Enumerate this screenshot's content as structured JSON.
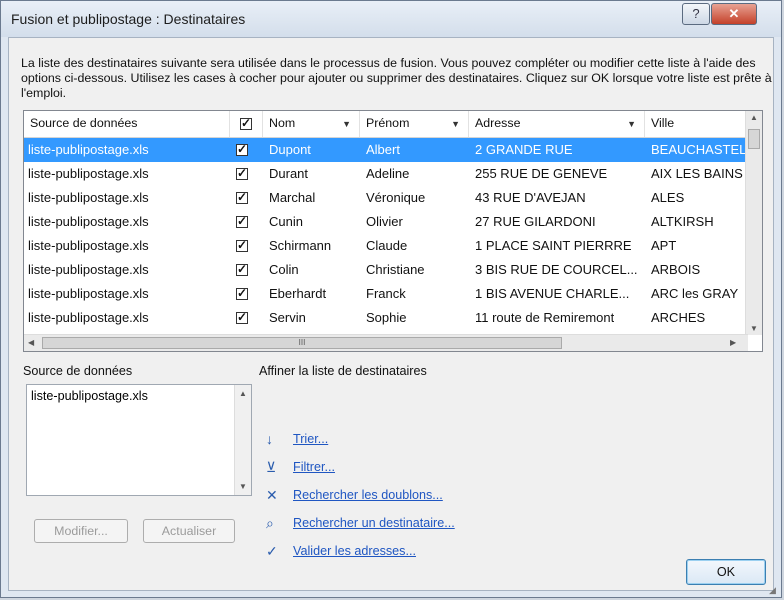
{
  "window": {
    "title": "Fusion et publipostage : Destinataires",
    "help_label": "?",
    "close_label": "✕"
  },
  "description": "La liste des destinataires suivante sera utilisée dans le processus de fusion. Vous pouvez compléter ou modifier cette liste à l'aide des options ci-dessous. Utilisez les cases à cocher pour ajouter ou supprimer des destinataires. Cliquez sur OK lorsque votre liste est prête à l'emploi.",
  "grid": {
    "columns": [
      "Source de données",
      "",
      "Nom",
      "Prénom",
      "Adresse",
      "Ville"
    ],
    "scroll_label": "III",
    "rows": [
      {
        "source": "liste-publipostage.xls",
        "checked": true,
        "nom": "Dupont",
        "prenom": "Albert",
        "adresse": "2 GRANDE RUE",
        "ville": "BEAUCHASTEL",
        "selected": true
      },
      {
        "source": "liste-publipostage.xls",
        "checked": true,
        "nom": "Durant",
        "prenom": "Adeline",
        "adresse": "255 RUE DE GENEVE",
        "ville": "AIX LES BAINS"
      },
      {
        "source": "liste-publipostage.xls",
        "checked": true,
        "nom": "Marchal",
        "prenom": "Véronique",
        "adresse": "43 RUE D'AVEJAN",
        "ville": "ALES"
      },
      {
        "source": "liste-publipostage.xls",
        "checked": true,
        "nom": "Cunin",
        "prenom": "Olivier",
        "adresse": "27 RUE GILARDONI",
        "ville": "ALTKIRSH"
      },
      {
        "source": "liste-publipostage.xls",
        "checked": true,
        "nom": "Schirmann",
        "prenom": "Claude",
        "adresse": "1 PLACE SAINT PIERRRE",
        "ville": "APT"
      },
      {
        "source": "liste-publipostage.xls",
        "checked": true,
        "nom": "Colin",
        "prenom": "Christiane",
        "adresse": "3 BIS RUE DE COURCEL...",
        "ville": "ARBOIS"
      },
      {
        "source": "liste-publipostage.xls",
        "checked": true,
        "nom": "Eberhardt",
        "prenom": "Franck",
        "adresse": "1 BIS AVENUE CHARLE...",
        "ville": "ARC les GRAY"
      },
      {
        "source": "liste-publipostage.xls",
        "checked": true,
        "nom": "Servin",
        "prenom": "Sophie",
        "adresse": "11 route de Remiremont",
        "ville": "ARCHES"
      }
    ]
  },
  "source_panel": {
    "label": "Source de données",
    "items": [
      "liste-publipostage.xls"
    ],
    "modify_label": "Modifier...",
    "refresh_label": "Actualiser"
  },
  "refine_panel": {
    "label": "Affiner la liste de destinataires",
    "links": [
      {
        "label": "Trier...",
        "icon": "sort-az-icon"
      },
      {
        "label": "Filtrer...",
        "icon": "filter-icon"
      },
      {
        "label": "Rechercher les doublons...",
        "icon": "duplicates-icon"
      },
      {
        "label": "Rechercher un destinataire...",
        "icon": "find-recipient-icon"
      },
      {
        "label": "Valider les adresses...",
        "icon": "validate-address-icon"
      }
    ]
  },
  "ok_label": "OK",
  "colors": {
    "selection": "#3399ff",
    "link": "#1f56c2"
  }
}
